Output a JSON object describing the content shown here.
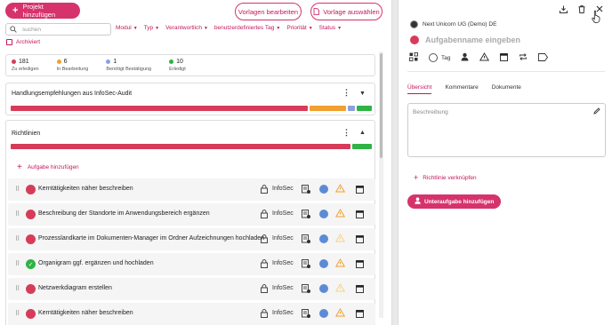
{
  "header": {
    "add_project_label": "Projekt hinzufügen",
    "edit_templates_label": "Vorlagen bearbeiten",
    "select_template_label": "Vorlage auswählen"
  },
  "search": {
    "placeholder": "suchen"
  },
  "filters": [
    {
      "label": "Modul"
    },
    {
      "label": "Typ"
    },
    {
      "label": "Verantwortlich"
    },
    {
      "label": "benutzerdefiniertes Tag"
    },
    {
      "label": "Priorität"
    },
    {
      "label": "Status"
    }
  ],
  "archived_label": "Archiviert",
  "stats": [
    {
      "count": "181",
      "label": "Zu erledigen",
      "color": "#d63c5a"
    },
    {
      "count": "6",
      "label": "In Bearbeitung",
      "color": "#f0a030"
    },
    {
      "count": "1",
      "label": "Benötigt Bestätigung",
      "color": "#8aa0e0"
    },
    {
      "count": "10",
      "label": "Erledigt",
      "color": "#2fb344"
    }
  ],
  "sections": [
    {
      "title": "Handlungsempfehlungen aus InfoSec-Audit"
    },
    {
      "title": "Richtlinien"
    }
  ],
  "add_task_label": "Aufgabe hinzufügen",
  "tasks": [
    {
      "name": "Kerntätigkeiten näher beschreiben",
      "org": "InfoSec",
      "status": "open"
    },
    {
      "name": "Beschreibung der Standorte im Anwendungsbereich ergänzen",
      "org": "InfoSec",
      "status": "open"
    },
    {
      "name": "Prozesslandkarte im Dokumenten-Manager im Ordner Aufzeichnungen hochladen",
      "org": "InfoSec",
      "status": "open"
    },
    {
      "name": "Organigram ggf. ergänzen und hochladen",
      "org": "InfoSec",
      "status": "done"
    },
    {
      "name": "Netzwerkdiagram erstellen",
      "org": "InfoSec",
      "status": "open"
    },
    {
      "name": "Kerntätigkeiten näher beschreiben",
      "org": "InfoSec",
      "status": "open"
    }
  ],
  "panel": {
    "company": "Next Unicorn UG (Demo) DE",
    "task_placeholder": "Aufgabenname eingeben",
    "tag_label": "Tag",
    "tabs": [
      "Übersicht",
      "Kommentare",
      "Dokumente"
    ],
    "description_placeholder": "Beschreibung",
    "link_guideline_label": "Richtlinie verknüpfen",
    "add_subtask_label": "Unteraufgabe hinzufügen"
  },
  "colors": {
    "accent": "#d6336c",
    "red": "#d63c5a",
    "orange": "#f0a030",
    "blue": "#8aa0e0",
    "green": "#2fb344"
  }
}
